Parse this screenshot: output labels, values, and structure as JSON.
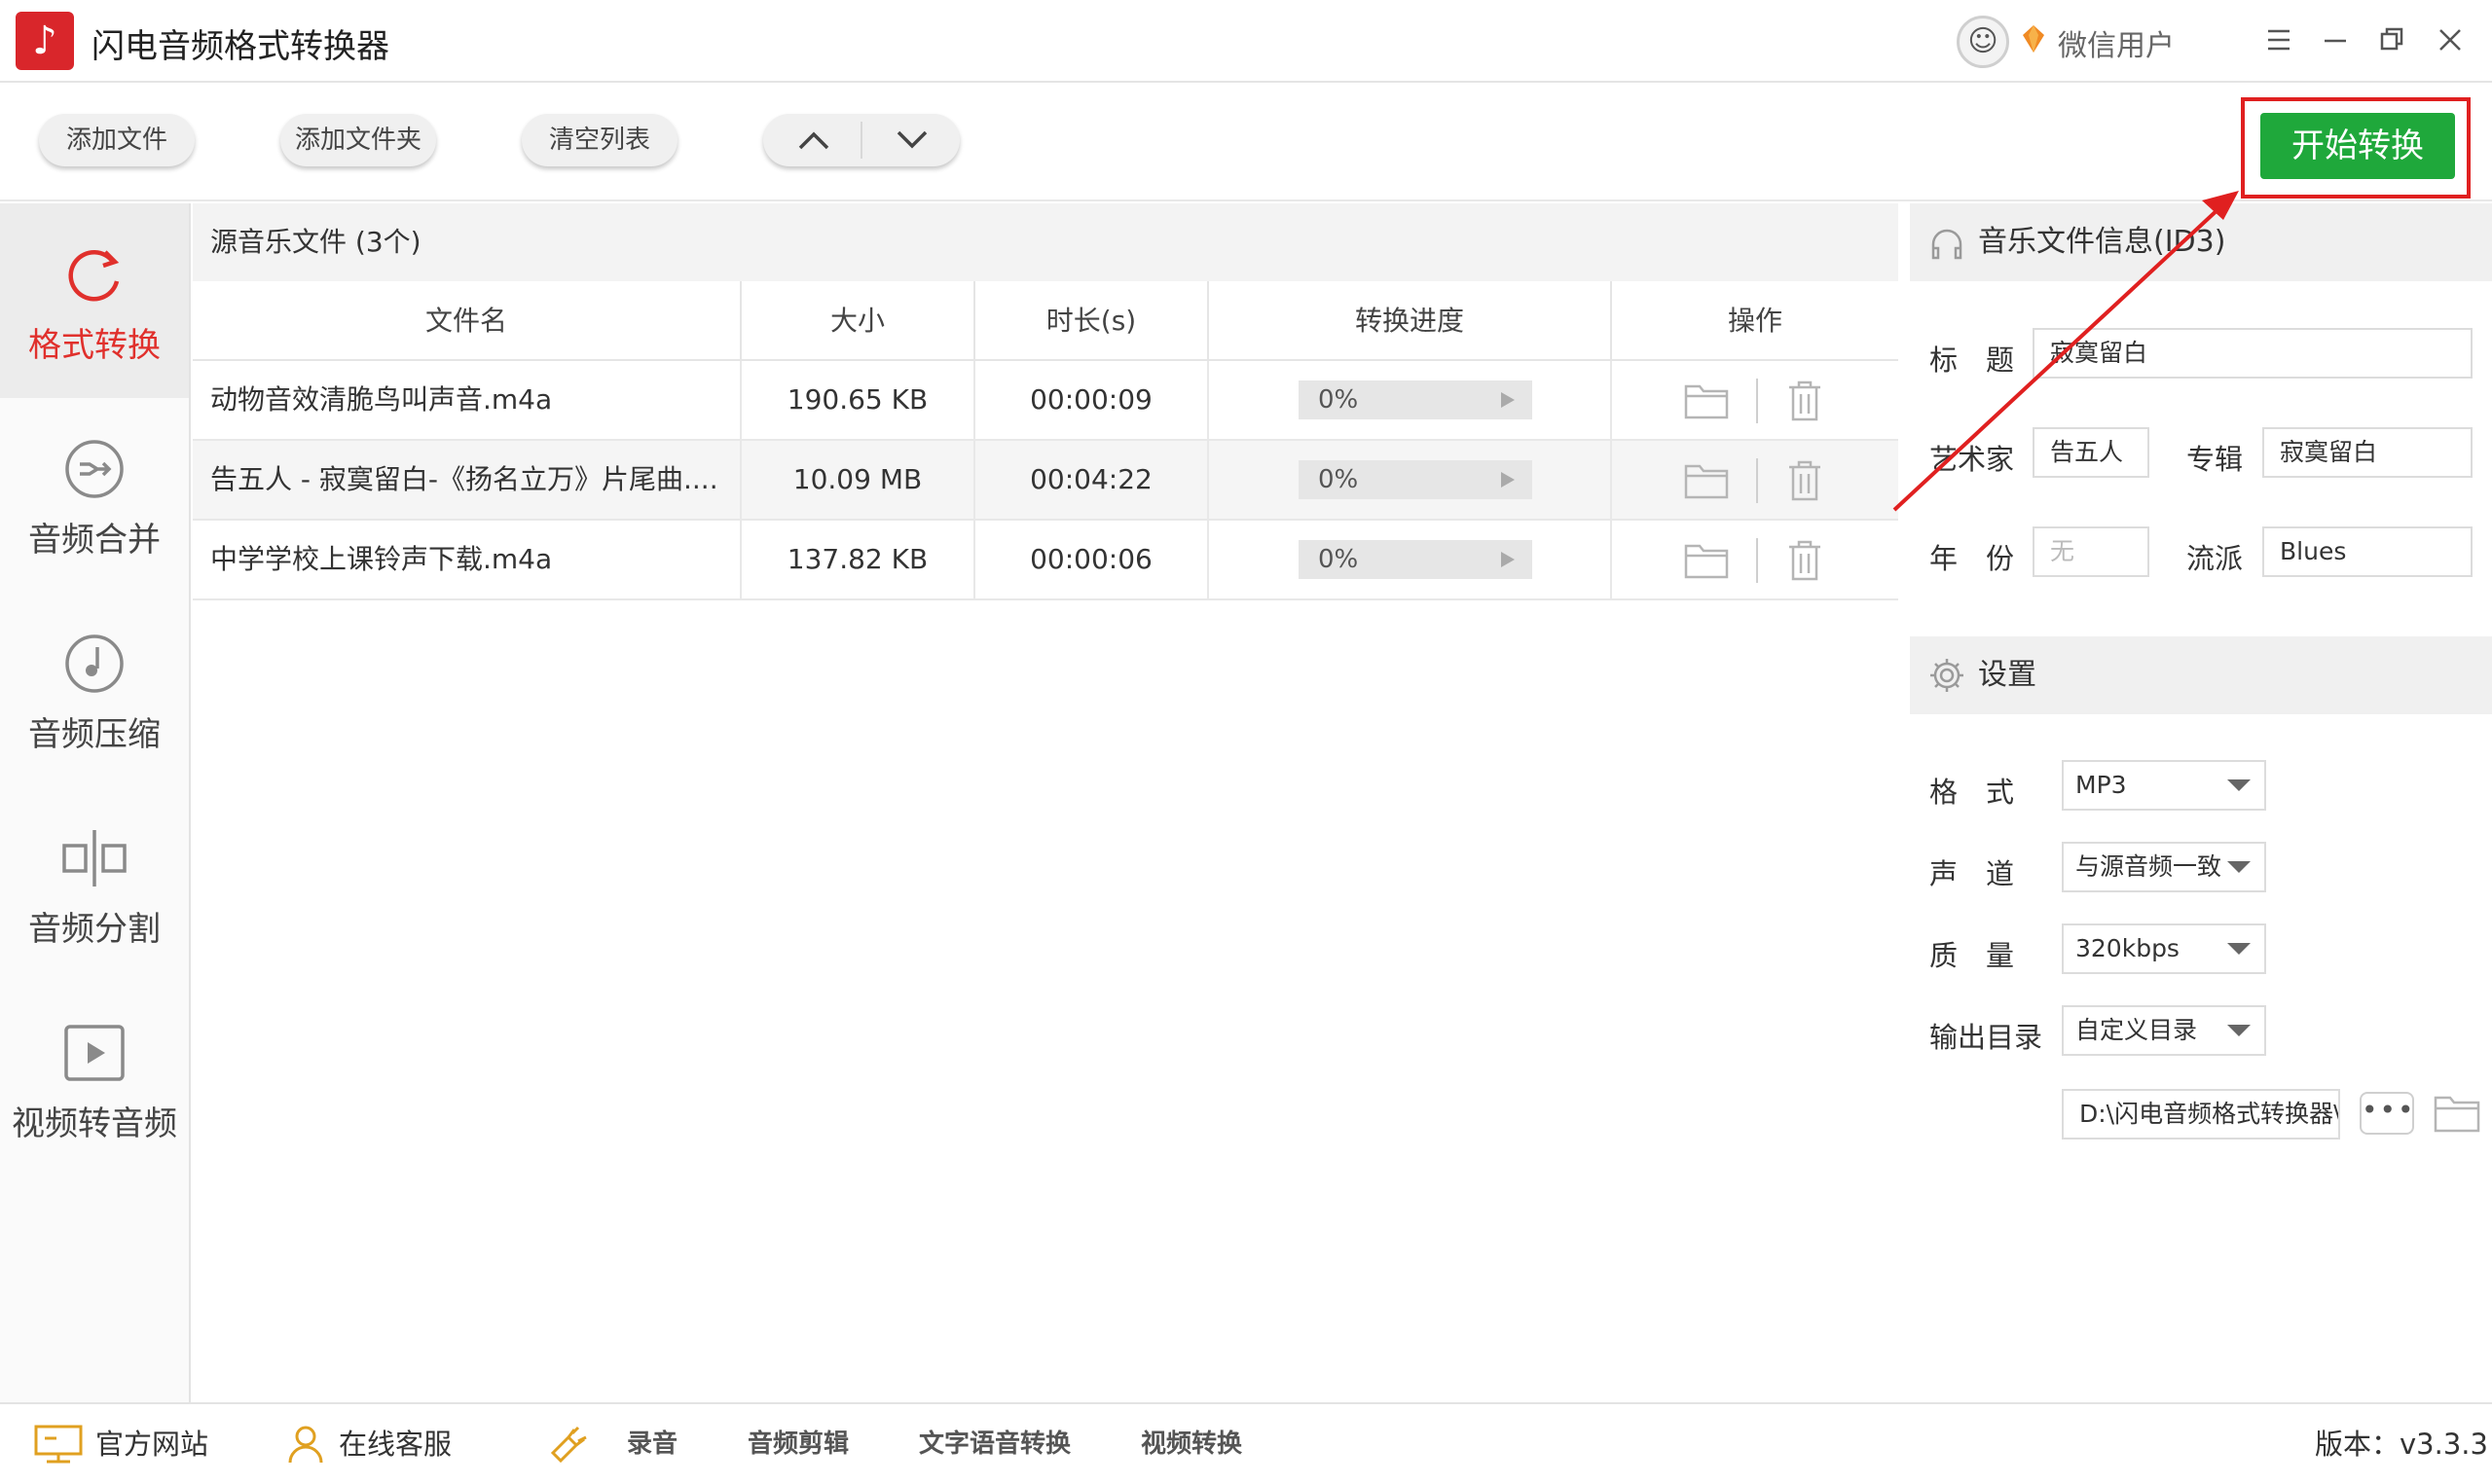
{
  "app": {
    "title": "闪电音频格式转换器",
    "logo_glyph": "♪",
    "user_name": "微信用户"
  },
  "toolbar": {
    "add_file": "添加文件",
    "add_folder": "添加文件夹",
    "clear_list": "清空列表",
    "start": "开始转换"
  },
  "sidebar": {
    "items": [
      {
        "label": "格式转换",
        "icon": "refresh-icon",
        "active": true
      },
      {
        "label": "音频合并",
        "icon": "merge-icon"
      },
      {
        "label": "音频压缩",
        "icon": "music-note-icon"
      },
      {
        "label": "音频分割",
        "icon": "split-icon"
      },
      {
        "label": "视频转音频",
        "icon": "video-play-icon"
      }
    ]
  },
  "file_list": {
    "header": "源音乐文件 (3个)",
    "columns": [
      "文件名",
      "大小",
      "时长(s)",
      "转换进度",
      "操作"
    ],
    "rows": [
      {
        "name": "动物音效清脆鸟叫声音.m4a",
        "size": "190.65 KB",
        "duration": "00:00:09",
        "progress": "0%"
      },
      {
        "name": "告五人 - 寂寞留白-《扬名立万》片尾曲....",
        "size": "10.09 MB",
        "duration": "00:04:22",
        "progress": "0%"
      },
      {
        "name": "中学学校上课铃声下载.m4a",
        "size": "137.82 KB",
        "duration": "00:00:06",
        "progress": "0%"
      }
    ]
  },
  "id3": {
    "heading": "音乐文件信息(ID3)",
    "title_label": "标　题",
    "title_value": "寂寞留白",
    "artist_label": "艺术家",
    "artist_value": "告五人",
    "album_label": "专辑",
    "album_value": "寂寞留白",
    "year_label": "年　份",
    "year_placeholder": "无",
    "genre_label": "流派",
    "genre_value": "Blues"
  },
  "settings": {
    "heading": "设置",
    "format_label": "格　式",
    "format_value": "MP3",
    "channel_label": "声　道",
    "channel_value": "与源音频一致",
    "quality_label": "质　量",
    "quality_value": "320kbps",
    "output_label": "输出目录",
    "output_value": "自定义目录",
    "path_value": "D:\\闪电音频格式转换器\\",
    "more_label": "•••"
  },
  "footer": {
    "website": "官方网站",
    "service": "在线客服",
    "record": "录音",
    "cut": "音频剪辑",
    "tts": "文字语音转换",
    "video": "视频转换",
    "version": "版本：v3.3.3"
  },
  "colors": {
    "accent_red": "#e0302c",
    "start_green": "#1fa83b",
    "annotation_red": "#e02020"
  }
}
